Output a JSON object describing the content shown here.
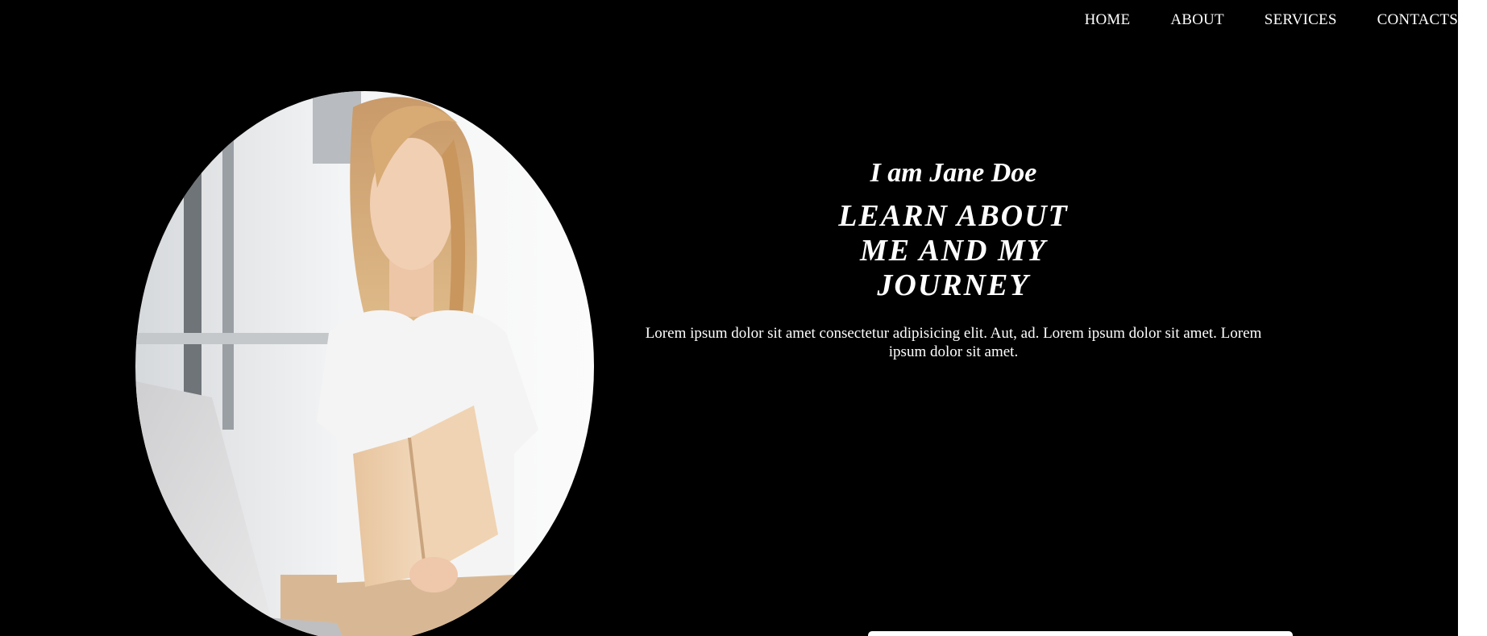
{
  "nav": {
    "home": "HOME",
    "about": "ABOUT",
    "services": "SERVICES",
    "contacts": "CONTACTS"
  },
  "hero": {
    "intro": "I am Jane Doe",
    "headline": "LEARN ABOUT ME AND MY JOURNEY",
    "description": "Lorem ipsum dolor sit amet consectetur adipisicing elit. Aut, ad. Lorem ipsum dolor sit amet. Lorem ipsum dolor sit amet."
  },
  "colors": {
    "background": "#000000",
    "text": "#ffffff"
  }
}
